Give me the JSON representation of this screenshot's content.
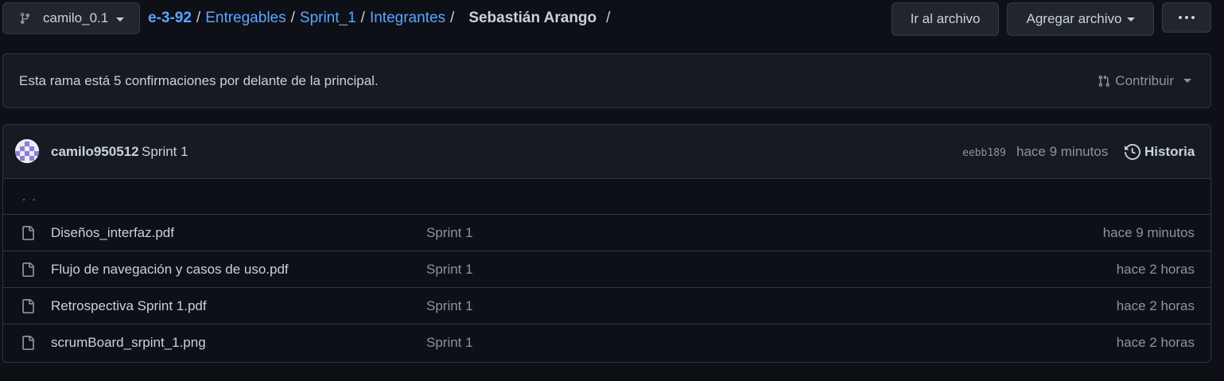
{
  "branch": {
    "name": "camilo_0.1",
    "icon": "git-branch-icon"
  },
  "breadcrumb": {
    "root": "e-3-92",
    "items": [
      "Entregables",
      "Sprint_1",
      "Integrantes"
    ],
    "current": "Sebastián Arango",
    "separator": "/"
  },
  "actions": {
    "goto_file": "Ir al archivo",
    "add_file": "Agregar archivo"
  },
  "ahead": {
    "text": "Esta rama está 5 confirmaciones por delante de la principal.",
    "contribute_label": "Contribuir"
  },
  "commit": {
    "author": "camilo950512",
    "message": "Sprint 1",
    "sha": "eebb189",
    "time": "hace 9 minutos",
    "history_label": "Historia"
  },
  "parent_link": ". .",
  "files": [
    {
      "name": "Diseños_interfaz.pdf",
      "commit": "Sprint 1",
      "time": "hace 9 minutos"
    },
    {
      "name": "Flujo de navegación y casos de uso.pdf",
      "commit": "Sprint 1",
      "time": "hace 2 horas"
    },
    {
      "name": "Retrospectiva Sprint 1.pdf",
      "commit": "Sprint 1",
      "time": "hace 2 horas"
    },
    {
      "name": "scrumBoard_srpint_1.png",
      "commit": "Sprint 1",
      "time": "hace 2 horas"
    }
  ],
  "colors": {
    "background": "#0d1117",
    "panel": "#161b22",
    "border": "#30363d",
    "link": "#58a6ff",
    "text": "#c9d1d9",
    "muted": "#8b949e"
  }
}
